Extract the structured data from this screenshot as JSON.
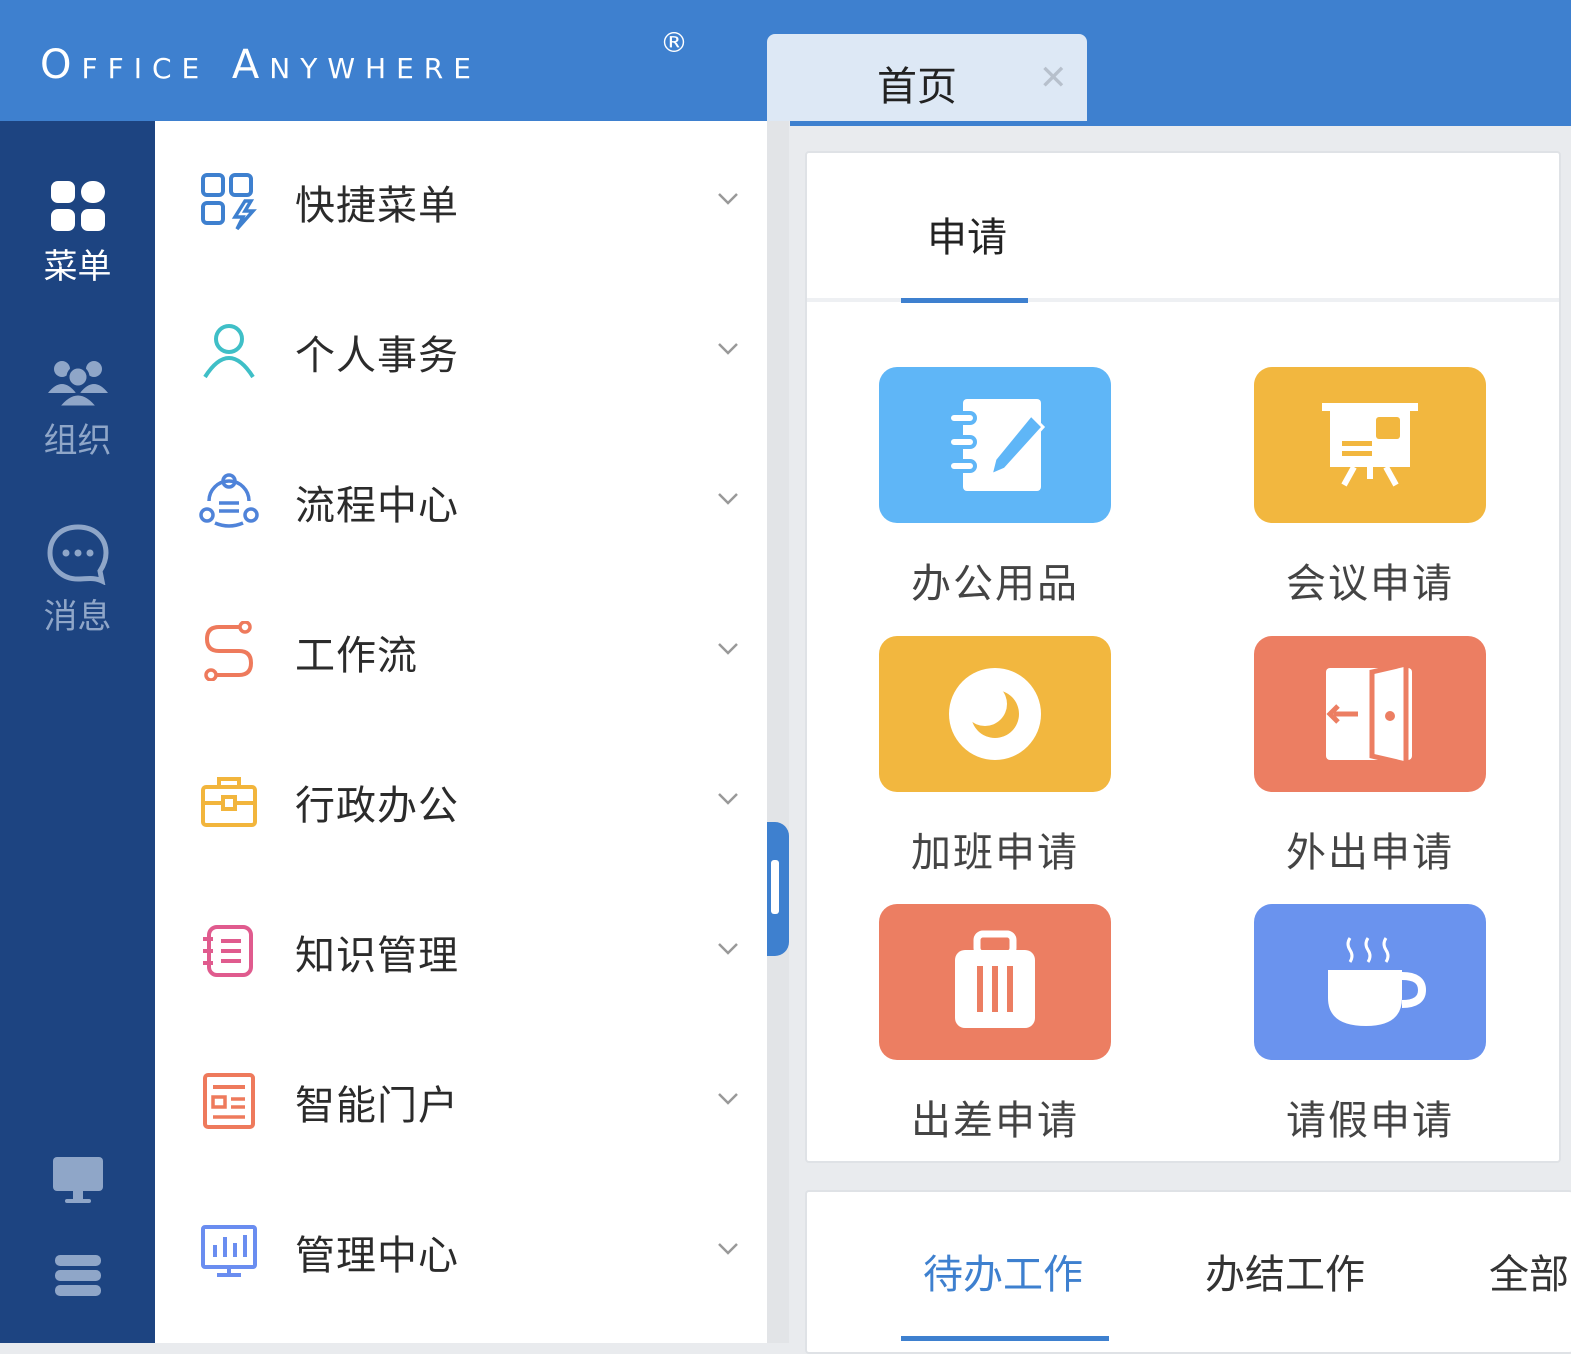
{
  "header": {
    "logo_text": "Office Anywhere",
    "logo_mark": "®",
    "tabs": [
      {
        "label": "首页",
        "close_icon": "close-icon"
      }
    ]
  },
  "rail": {
    "items": [
      {
        "label": "菜单",
        "icon": "grid-icon",
        "active": true
      },
      {
        "label": "组织",
        "icon": "users-icon",
        "active": false
      },
      {
        "label": "消息",
        "icon": "chat-icon",
        "active": false
      }
    ],
    "bottom_icons": [
      "monitor-icon",
      "server-icon"
    ]
  },
  "menu": {
    "items": [
      {
        "label": "快捷菜单",
        "icon": "quick-menu-icon",
        "color": "#3e80cf"
      },
      {
        "label": "个人事务",
        "icon": "person-icon",
        "color": "#3fbfc7"
      },
      {
        "label": "流程中心",
        "icon": "flow-center-icon",
        "color": "#4f83d9"
      },
      {
        "label": "工作流",
        "icon": "workflow-icon",
        "color": "#ee7a5c"
      },
      {
        "label": "行政办公",
        "icon": "briefcase-icon",
        "color": "#f2b53c"
      },
      {
        "label": "知识管理",
        "icon": "notebook-icon",
        "color": "#e05b8e"
      },
      {
        "label": "智能门户",
        "icon": "portal-icon",
        "color": "#ee7a5c"
      },
      {
        "label": "管理中心",
        "icon": "chart-screen-icon",
        "color": "#6a8df0"
      }
    ]
  },
  "apply_card": {
    "tab": "申请",
    "apps": [
      {
        "label": "办公用品",
        "icon": "notepad-icon",
        "color": "#5fb6f7"
      },
      {
        "label": "会议申请",
        "icon": "presentation-icon",
        "color": "#f2b73f"
      },
      {
        "label": "加班申请",
        "icon": "moon-icon",
        "color": "#f2b73f"
      },
      {
        "label": "外出申请",
        "icon": "door-exit-icon",
        "color": "#ec7e62"
      },
      {
        "label": "出差申请",
        "icon": "luggage-icon",
        "color": "#ec7e62"
      },
      {
        "label": "请假申请",
        "icon": "coffee-icon",
        "color": "#6a93ee"
      }
    ]
  },
  "work_card": {
    "tabs": [
      {
        "label": "待办工作",
        "active": true
      },
      {
        "label": "办结工作",
        "active": false
      },
      {
        "label": "全部",
        "active": false
      }
    ]
  },
  "colors": {
    "accent": "#3e80cf",
    "rail": "#1d4481",
    "active_text": "#3e80cf"
  }
}
